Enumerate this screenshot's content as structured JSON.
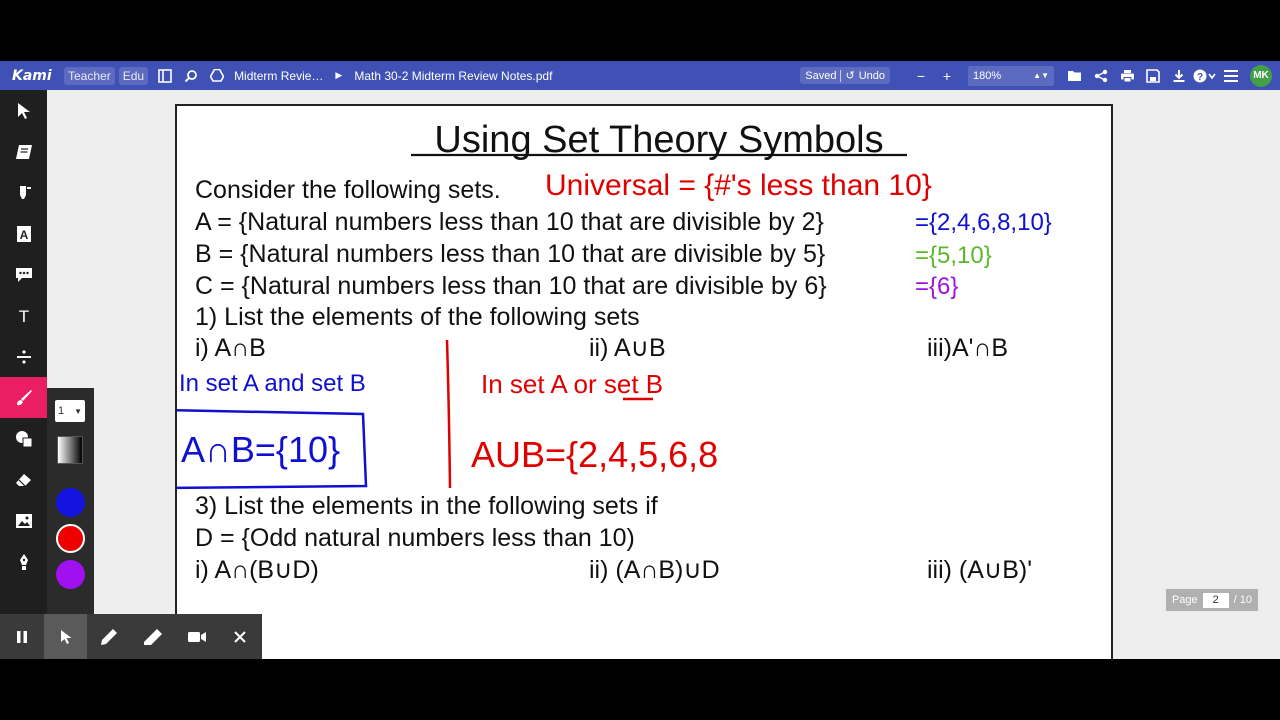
{
  "app": {
    "logo": "Kami",
    "role_chip": "Teacher",
    "edu_chip": "Edu",
    "folder_name": "Midterm Revie…",
    "file_name": "Math 30-2 Midterm Review Notes.pdf",
    "saved_label": "Saved",
    "undo_label": "Undo",
    "zoom_value": "180%",
    "avatar_initials": "MK"
  },
  "tool_panel": {
    "stroke_size": "1",
    "colors": [
      "#1414e0",
      "#ee0000",
      "#a010f0"
    ]
  },
  "document": {
    "title": "Using Set Theory Symbols",
    "line_consider": "Consider the following sets.",
    "set_a": "A = {Natural numbers less than 10 that are divisible by 2}",
    "set_b": "B = {Natural numbers less than 10 that are divisible by 5}",
    "set_c": "C = {Natural numbers less than 10 that are divisible by 6}",
    "q1": "1) List the elements of the following sets",
    "q1_i": "i) A∩B",
    "q1_ii": "ii) A∪B",
    "q1_iii": "iii)A'∩B",
    "q3": "3) List the elements in the following sets if",
    "set_d": "D = {Odd natural numbers less than 10)",
    "q3_i": "i) A∩(B∪D)",
    "q3_ii": "ii) (A∩B)∪D",
    "q3_iii": "iii) (A∪B)'"
  },
  "ink": {
    "universal": "Universal = {#'s less than 10}",
    "a_elems": "={2,4,6,8,10}",
    "b_elems": "={5,10}",
    "c_elems": "={6}",
    "in_a_and_b": "In set A and set B",
    "in_a_or_b_prefix": "In set A ",
    "in_a_or_b_or": "or",
    "in_a_or_b_suffix": " set B",
    "a_int_b": "A∩B={10}",
    "a_union_b": "AUB={2,4,5,6,8"
  },
  "ink_colors": {
    "red": "#e00000",
    "blue": "#1010d0",
    "green": "#5cb82a",
    "purple": "#a010e0"
  },
  "pager": {
    "label": "Page",
    "current": "2",
    "total": "/ 10"
  }
}
